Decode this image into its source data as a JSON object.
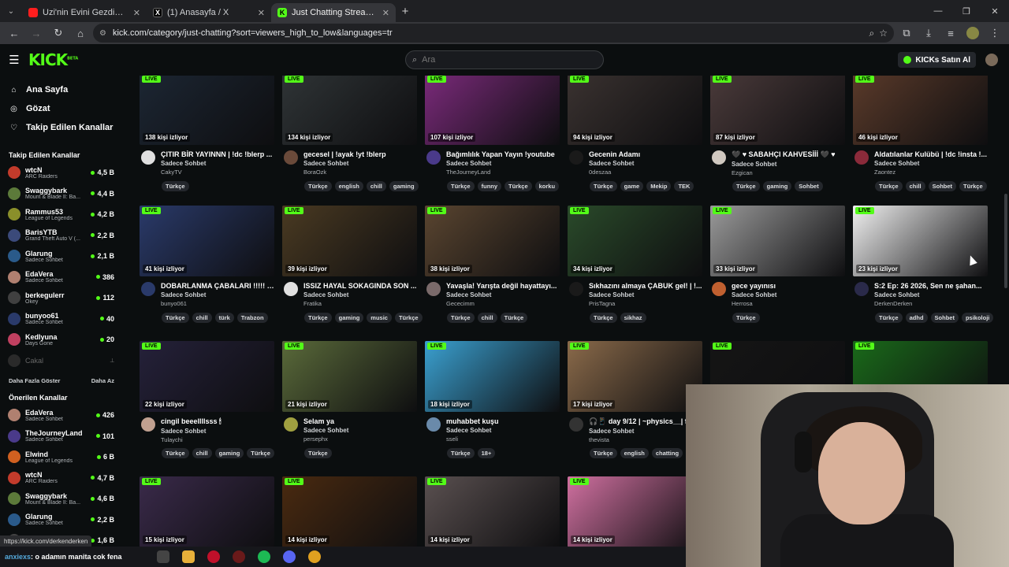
{
  "browser": {
    "tabs": [
      {
        "title": "Uzi'nin Evini Gezdim ve Kurbağ",
        "favicon": "youtube-icon",
        "active": false
      },
      {
        "title": "(1) Anasayfa / X",
        "favicon": "x-icon",
        "active": false
      },
      {
        "title": "Just Chatting Streaming - Live",
        "favicon": "kick-icon",
        "active": true
      }
    ],
    "url": "kick.com/category/just-chatting?sort=viewers_high_to_low&languages=tr",
    "status_url": "https://kick.com/derkenderken"
  },
  "header": {
    "logo": "KICK",
    "logo_sup": "BETA",
    "search_placeholder": "Ara",
    "kicks_button": "KICKs Satın Al"
  },
  "sidebar": {
    "nav": [
      {
        "label": "Ana Sayfa",
        "icon": "home-icon"
      },
      {
        "label": "Gözat",
        "icon": "compass-icon"
      },
      {
        "label": "Takip Edilen Kanallar",
        "icon": "heart-icon"
      }
    ],
    "followed_title": "Takip Edilen Kanallar",
    "followed": [
      {
        "name": "wtcN",
        "category": "ARC Raiders",
        "viewers": "4,5 B",
        "color": "#c23b2b"
      },
      {
        "name": "Swaggybark",
        "category": "Mount & Blade II: Ba...",
        "viewers": "4,4 B",
        "color": "#5c7a3a"
      },
      {
        "name": "Rammus53",
        "category": "League of Legends",
        "viewers": "4,2 B",
        "color": "#8a8f2a"
      },
      {
        "name": "BarisYTB",
        "category": "Grand Theft Auto V (...",
        "viewers": "2,2 B",
        "color": "#3b4a7a"
      },
      {
        "name": "Glarung",
        "category": "Sadece Sohbet",
        "viewers": "2,1 B",
        "color": "#2a5a8a"
      },
      {
        "name": "EdaVera",
        "category": "Sadece Sohbet",
        "viewers": "386",
        "color": "#b08070"
      },
      {
        "name": "berkegulerr",
        "category": "Okey",
        "viewers": "112",
        "color": "#404040"
      },
      {
        "name": "bunyoo61",
        "category": "Sadece Sohbet",
        "viewers": "40",
        "color": "#2a3a6a"
      },
      {
        "name": "Kedlyuna",
        "category": "Days Gone",
        "viewers": "20",
        "color": "#c04060"
      }
    ],
    "offline": {
      "name": "Cakal",
      "status": "⟂"
    },
    "show_more": "Daha Fazla Göster",
    "show_less": "Daha Az",
    "recommended_title": "Önerilen Kanallar",
    "recommended": [
      {
        "name": "EdaVera",
        "category": "Sadece Sohbet",
        "viewers": "426",
        "color": "#b08070"
      },
      {
        "name": "TheJourneyLand",
        "category": "Sadece Sohbet",
        "viewers": "101",
        "color": "#4a3a8a"
      },
      {
        "name": "Elwind",
        "category": "League of Legends",
        "viewers": "6 B",
        "color": "#d06020"
      },
      {
        "name": "wtcN",
        "category": "ARC Raiders",
        "viewers": "4,7 B",
        "color": "#c23b2b"
      },
      {
        "name": "Swaggybark",
        "category": "Mount & Blade II: Ba...",
        "viewers": "4,6 B",
        "color": "#5c7a3a"
      },
      {
        "name": "Glarung",
        "category": "Sadece Sohbet",
        "viewers": "2,2 B",
        "color": "#2a5a8a"
      },
      {
        "name": "",
        "category": "",
        "viewers": "1,6 B",
        "color": "#444"
      }
    ]
  },
  "live_label": "LIVE",
  "streams": [
    {
      "viewers": "138 kişi izliyor",
      "title": "ÇITIR BİR YAYINNN | !dc !blerp ...",
      "category": "Sadece Sohbet",
      "channel": "CakyTV",
      "tags": [
        "Türkçe"
      ],
      "thumb": "#1c2633",
      "avatar": "#e0e0e0"
    },
    {
      "viewers": "134 kişi izliyor",
      "title": "gecesel | !ayak !yt !blerp",
      "category": "Sadece Sohbet",
      "channel": "BoraOzk",
      "tags": [
        "Türkçe",
        "english",
        "chill",
        "gaming"
      ],
      "thumb": "#2f3436",
      "avatar": "#6a4a3a"
    },
    {
      "viewers": "107 kişi izliyor",
      "title": "Bağımlılık Yapan Yayın !youtube",
      "category": "Sadece Sohbet",
      "channel": "TheJourneyLand",
      "tags": [
        "Türkçe",
        "funny",
        "Türkçe",
        "korku"
      ],
      "thumb": "#7a2a7a",
      "avatar": "#4a3a8a"
    },
    {
      "viewers": "94 kişi izliyor",
      "title": "Gecenin Adamı",
      "category": "Sadece Sohbet",
      "channel": "0deszaa",
      "tags": [
        "Türkçe",
        "game",
        "Mekip",
        "TEK"
      ],
      "thumb": "#3a3230",
      "avatar": "#1a1a1a"
    },
    {
      "viewers": "87 kişi izliyor",
      "title": "🖤 ♥ SABAHÇI KAHVESİİİ 🖤 ♥",
      "category": "Sadece Sohbet",
      "channel": "Ezgican",
      "tags": [
        "Türkçe",
        "gaming",
        "Sohbet"
      ],
      "thumb": "#4a3a3a",
      "avatar": "#d0c8c0"
    },
    {
      "viewers": "46 kişi izliyor",
      "title": "Aldatılanlar Kulübü | !dc !insta !...",
      "category": "Sadece Sohbet",
      "channel": "Zaontez",
      "tags": [
        "Türkçe",
        "chill",
        "Sohbet",
        "Türkçe"
      ],
      "thumb": "#5a3a2a",
      "avatar": "#8a2a3a"
    },
    {
      "viewers": "41 kişi izliyor",
      "title": "DOBARLANMA ÇABALARI !!!!! !...",
      "category": "Sadece Sohbet",
      "channel": "bunyo061",
      "tags": [
        "Türkçe",
        "chill",
        "türk",
        "Trabzon"
      ],
      "thumb": "#2a3a6a",
      "avatar": "#2a3a6a"
    },
    {
      "viewers": "39 kişi izliyor",
      "title": "ISSIZ HAYAL SOKAGINDA SON ...",
      "category": "Sadece Sohbet",
      "channel": "Fratika",
      "tags": [
        "Türkçe",
        "gaming",
        "music",
        "Türkçe"
      ],
      "thumb": "#4a3a22",
      "avatar": "#e0e0e0"
    },
    {
      "viewers": "38 kişi izliyor",
      "title": "Yavaşla! Yarışta değil hayattayı...",
      "category": "Sadece Sohbet",
      "channel": "Gececimm",
      "tags": [
        "Türkçe",
        "chill",
        "Türkçe"
      ],
      "thumb": "#5a4530",
      "avatar": "#7a6a6a"
    },
    {
      "viewers": "34 kişi izliyor",
      "title": "Sıkhazını almaya ÇABUK gel! | !...",
      "category": "Sadece Sohbet",
      "channel": "PrisTagna",
      "tags": [
        "Türkçe",
        "sikhaz"
      ],
      "thumb": "#2a4a2a",
      "avatar": "#1a1a1a"
    },
    {
      "viewers": "33 kişi izliyor",
      "title": "gece yayınısı",
      "category": "Sadece Sohbet",
      "channel": "Herrosa",
      "tags": [
        "Türkçe"
      ],
      "thumb": "#9a9a9a",
      "avatar": "#c06030"
    },
    {
      "viewers": "23 kişi izliyor",
      "title": "S:2 Ep: 26 2026, Sen ne şahan...",
      "category": "Sadece Sohbet",
      "channel": "DerkenDerken",
      "tags": [
        "Türkçe",
        "adhd",
        "Sohbet",
        "psikoloji"
      ],
      "thumb": "#f0f0f0",
      "avatar": "#2a2a4a"
    },
    {
      "viewers": "22 kişi izliyor",
      "title": "cingil beeellllsss 🕯",
      "category": "Sadece Sohbet",
      "channel": "Tulaychi",
      "tags": [
        "Türkçe",
        "chill",
        "gaming",
        "Türkçe"
      ],
      "thumb": "#25213a",
      "avatar": "#c0a090"
    },
    {
      "viewers": "21 kişi izliyor",
      "title": "Selam ya",
      "category": "Sadece Sohbet",
      "channel": "persephx",
      "tags": [
        "Türkçe"
      ],
      "thumb": "#5a6a3a",
      "avatar": "#a0a040"
    },
    {
      "viewers": "18 kişi izliyor",
      "title": "muhabbet kuşu",
      "category": "Sadece Sohbet",
      "channel": "sseli",
      "tags": [
        "Türkçe",
        "18+"
      ],
      "thumb": "#3aa0d0",
      "avatar": "#6a8aaa"
    },
    {
      "viewers": "17 kişi izliyor",
      "title": "🎧📱 day 9/12 | ~physics__| fi",
      "category": "Sadece Sohbet",
      "channel": "thevista",
      "tags": [
        "Türkçe",
        "english",
        "chatting"
      ],
      "thumb": "#8a6a4a",
      "avatar": "#333"
    },
    {
      "viewers": "",
      "title": "",
      "category": "",
      "channel": "",
      "tags": [],
      "thumb": "#151515",
      "avatar": "#333"
    },
    {
      "viewers": "",
      "title": "",
      "category": "",
      "channel": "",
      "tags": [],
      "thumb": "#1a6a1a",
      "avatar": "#333"
    },
    {
      "viewers": "15 kişi izliyor",
      "title": "",
      "category": "",
      "channel": "",
      "tags": [],
      "thumb": "#3a2a4a",
      "avatar": "#333"
    },
    {
      "viewers": "14 kişi izliyor",
      "title": "",
      "category": "",
      "channel": "",
      "tags": [],
      "thumb": "#4a2a10",
      "avatar": "#333"
    },
    {
      "viewers": "14 kişi izliyor",
      "title": "",
      "category": "",
      "channel": "",
      "tags": [],
      "thumb": "#5a5050",
      "avatar": "#333"
    },
    {
      "viewers": "14 kişi izliyor",
      "title": "",
      "category": "",
      "channel": "",
      "tags": [],
      "thumb": "#d070a0",
      "avatar": "#333"
    }
  ],
  "taskbar": {
    "ticker_user": "anxiexs",
    "ticker_text": ": o adamın manita cok fena"
  }
}
